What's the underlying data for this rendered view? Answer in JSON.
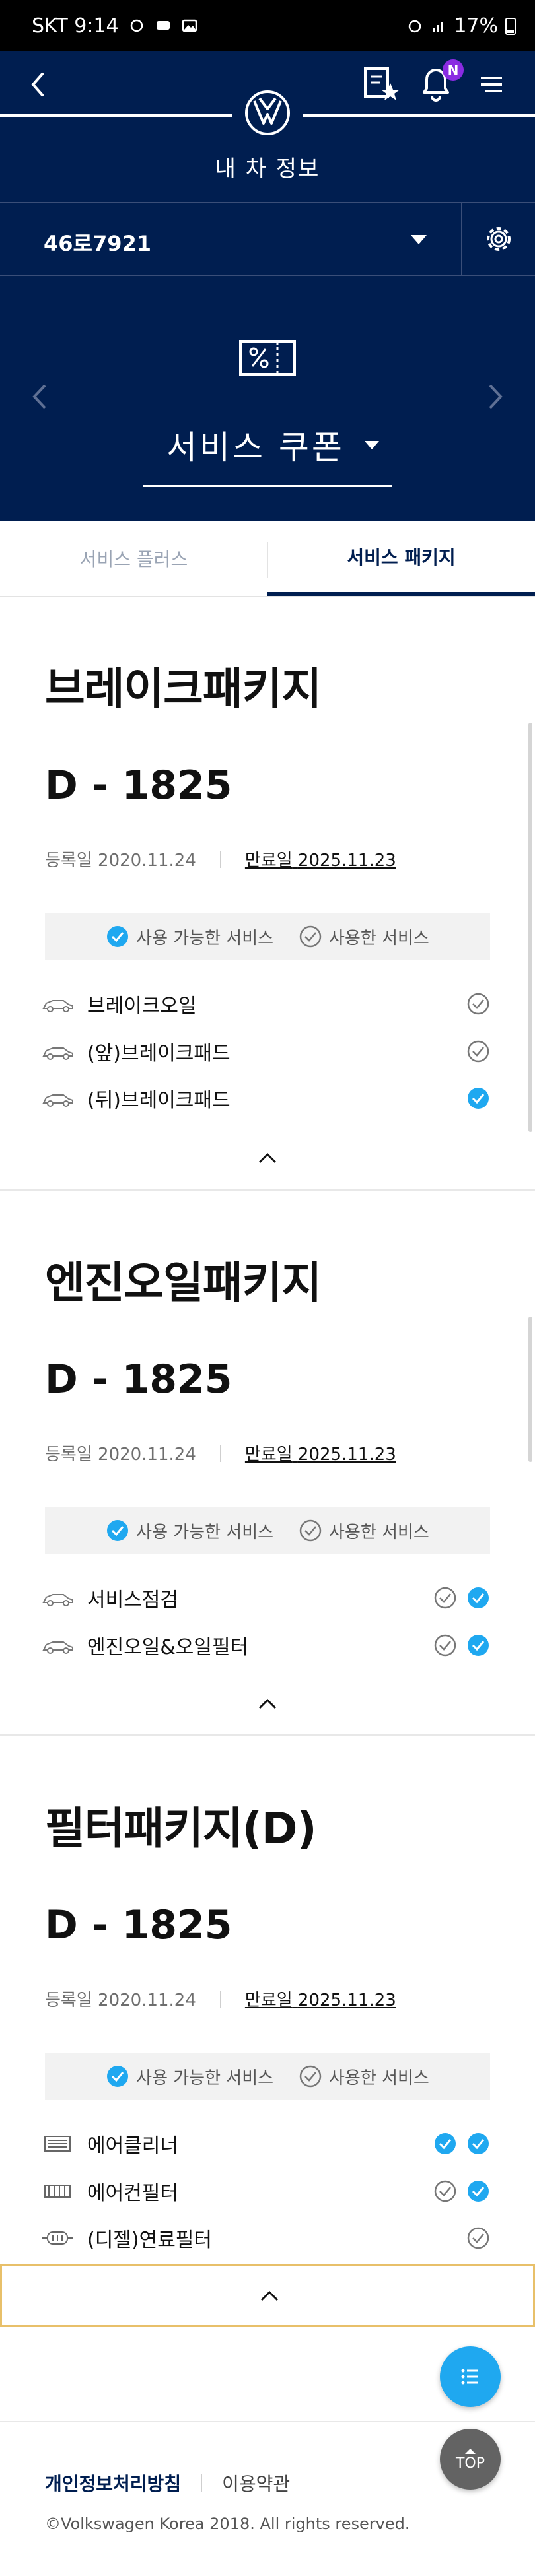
{
  "status_bar": {
    "carrier_time": "SKT 9:14",
    "battery": "17%"
  },
  "header": {
    "title": "내 차 정보",
    "car_number": "46로7921",
    "coupon_title": "서비스 쿠폰",
    "notification_badge": "N",
    "accent_color": "#001e50"
  },
  "tabs": [
    {
      "label": "서비스 플러스",
      "active": false
    },
    {
      "label": "서비스 패키지",
      "active": true
    }
  ],
  "legend": {
    "available": "사용 가능한 서비스",
    "used": "사용한 서비스"
  },
  "packages": [
    {
      "title": "브레이크패키지",
      "dday": "D - 1825",
      "registered": "등록일 2020.11.24",
      "expiry_label": "만료일",
      "expiry": "2025.11.23",
      "services": [
        {
          "label": "브레이크오일",
          "icon": "car-icon",
          "checks": [
            "used"
          ]
        },
        {
          "label": "(앞)브레이크패드",
          "icon": "car-icon",
          "checks": [
            "used"
          ]
        },
        {
          "label": "(뒤)브레이크패드",
          "icon": "car-icon",
          "checks": [
            "available"
          ]
        }
      ]
    },
    {
      "title": "엔진오일패키지",
      "dday": "D - 1825",
      "registered": "등록일 2020.11.24",
      "expiry_label": "만료일",
      "expiry": "2025.11.23",
      "services": [
        {
          "label": "서비스점검",
          "icon": "car-icon",
          "checks": [
            "used",
            "available"
          ]
        },
        {
          "label": "엔진오일&오일필터",
          "icon": "car-icon",
          "checks": [
            "used",
            "available"
          ]
        }
      ]
    },
    {
      "title": "필터패키지(D)",
      "dday": "D - 1825",
      "registered": "등록일 2020.11.24",
      "expiry_label": "만료일",
      "expiry": "2025.11.23",
      "services": [
        {
          "label": "에어클리너",
          "icon": "air-cleaner-icon",
          "checks": [
            "available",
            "available"
          ]
        },
        {
          "label": "에어컨필터",
          "icon": "ac-filter-icon",
          "checks": [
            "used",
            "available"
          ]
        },
        {
          "label": "(디젤)연료필터",
          "icon": "fuel-filter-icon",
          "checks": [
            "used"
          ]
        }
      ]
    }
  ],
  "fab": {
    "top_label": "TOP"
  },
  "footer": {
    "privacy": "개인정보처리방침",
    "terms": "이용약관",
    "copyright": "©Volkswagen Korea 2018. All rights reserved."
  }
}
